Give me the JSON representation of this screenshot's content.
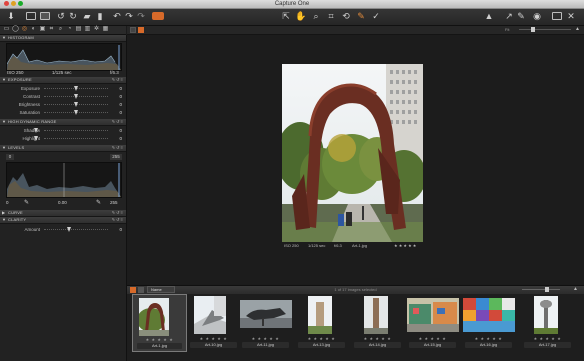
{
  "window": {
    "title": "Capture One"
  },
  "toolbar": {
    "left_icons": [
      "import-icon",
      "capture-icon",
      "viewer-icon",
      "rotate-left-icon",
      "rotate-right-icon",
      "folder-icon",
      "trash-icon",
      "undo-icon",
      "redo-icon",
      "reset-icon",
      "styles-icon"
    ],
    "center_tools": [
      "cursor-tool",
      "pan-tool",
      "zoom-tool",
      "crop-tool",
      "rotate-tool",
      "keystone-tool",
      "color-picker-tool",
      "spot-tool"
    ],
    "right_icons": [
      "warning-icon",
      "edit-icon",
      "pencil-icon",
      "settings-icon",
      "proof-icon",
      "tools-icon"
    ]
  },
  "left_panel": {
    "histogram": {
      "title": "HISTOGRAM",
      "iso": "ISO 250",
      "shutter": "1/125 sec",
      "aperture": "f/6.3"
    },
    "exposure": {
      "title": "EXPOSURE",
      "rows": [
        {
          "label": "Exposure",
          "value": "0",
          "pos": 0.5
        },
        {
          "label": "Contrast",
          "value": "0",
          "pos": 0.5
        },
        {
          "label": "Brightness",
          "value": "0",
          "pos": 0.5
        },
        {
          "label": "Saturation",
          "value": "0",
          "pos": 0.5
        }
      ]
    },
    "hdr": {
      "title": "HIGH DYNAMIC RANGE",
      "rows": [
        {
          "label": "Shadow",
          "value": "0",
          "pos": 0.0
        },
        {
          "label": "Highlight",
          "value": "0",
          "pos": 0.0
        }
      ]
    },
    "levels": {
      "title": "LEVELS",
      "low": "0",
      "high": "255",
      "out_low": "0",
      "mid": "0.00",
      "out_high": "255"
    },
    "curve": {
      "title": "CURVE"
    },
    "clarity": {
      "title": "CLARITY",
      "rows": [
        {
          "label": "Amount",
          "value": "0",
          "pos": 0.5
        }
      ]
    }
  },
  "viewer": {
    "zoom": "Fit",
    "photo_info": {
      "iso": "ISO 250",
      "shutter": "1/125 sec",
      "aperture": "f/6.3",
      "file": "Art-1.jpg",
      "rating_stars": "★ ★ ★ ★ ★"
    }
  },
  "browser": {
    "sort_label": "Name",
    "count_text": "1 of 17 images selected",
    "thumbnails": [
      {
        "name": "Art-1.jpg",
        "selected": true
      },
      {
        "name": "Art-10.jpg",
        "selected": false
      },
      {
        "name": "Art-11.jpg",
        "selected": false
      },
      {
        "name": "Art-13.jpg",
        "selected": false
      },
      {
        "name": "Art-14.jpg",
        "selected": false
      },
      {
        "name": "Art-15.jpg",
        "selected": false
      },
      {
        "name": "Art-16.jpg",
        "selected": false
      },
      {
        "name": "Art-17.jpg",
        "selected": false
      }
    ],
    "stars": "★ ★ ★ ★ ★"
  }
}
